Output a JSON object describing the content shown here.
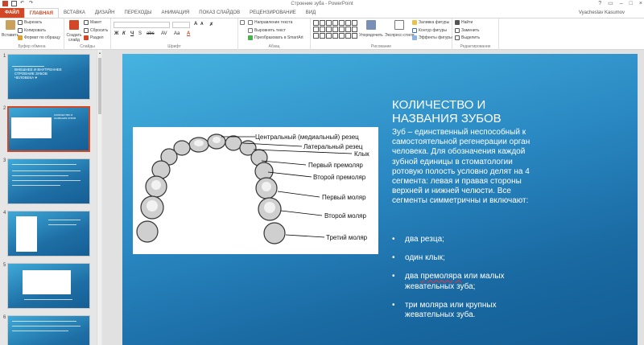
{
  "window": {
    "title": "Строение зуба - PowerPoint",
    "user": "Vyacheslav Kasumov",
    "controls": [
      "?",
      "▭",
      "–",
      "□",
      "×"
    ]
  },
  "ribbon": {
    "tabs": [
      "ФАЙЛ",
      "ГЛАВНАЯ",
      "ВСТАВКА",
      "ДИЗАЙН",
      "ПЕРЕХОДЫ",
      "АНИМАЦИЯ",
      "ПОКАЗ СЛАЙДОВ",
      "РЕЦЕНЗИРОВАНИЕ",
      "ВИД"
    ],
    "active_tab": "ГЛАВНАЯ",
    "clipboard": {
      "paste": "Вставить",
      "cut": "Вырезать",
      "copy": "Копировать",
      "format_painter": "Формат по образцу",
      "label": "Буфер обмена"
    },
    "slides": {
      "new_slide": "Создать слайд",
      "layout": "Макет",
      "reset": "Сбросить",
      "section": "Раздел",
      "label": "Слайды"
    },
    "font": {
      "name": "",
      "size": "",
      "bold": "Ж",
      "italic": "К",
      "underline": "Ч",
      "strike": "S",
      "shadow": "abc",
      "spacing": "AV",
      "case": "Aa",
      "label": "Шрифт"
    },
    "paragraph": {
      "text_direction": "Направление текста",
      "align_text": "Выровнять текст",
      "smartart": "Преобразовать в SmartArt",
      "label": "Абзац"
    },
    "drawing": {
      "arrange": "Упорядочить",
      "quick_styles": "Экспресс-стили",
      "fill": "Заливка фигуры",
      "outline": "Контур фигуры",
      "effects": "Эффекты фигуры",
      "label": "Рисование"
    },
    "editing": {
      "find": "Найти",
      "replace": "Заменить",
      "select": "Выделить",
      "label": "Редактирование"
    }
  },
  "thumbnails": [
    {
      "number": "1",
      "text": "ВНЕШНЕЕ И ВНУТРЕННЕЕ СТРОЕНИЕ ЗУБОВ ЧЕЛОВЕКА ♥"
    },
    {
      "number": "2",
      "text": "КОЛИЧЕСТВО И НАЗВАНИЯ ЗУБОВ"
    },
    {
      "number": "3",
      "text": ""
    },
    {
      "number": "4",
      "text": ""
    },
    {
      "number": "5",
      "text": ""
    },
    {
      "number": "6",
      "text": ""
    }
  ],
  "slide": {
    "title": "КОЛИЧЕСТВО И НАЗВАНИЯ ЗУБОВ",
    "paragraph": "Зуб – единственный неспособный к самостоятельной регенерации орган человека. Для обозначения каждой зубной единицы в стоматологии ротовую полость условно делят на 4 сегмента: левая и правая стороны верхней и нижней челюсти. Все сегменты симметричны и включают:",
    "bullets": [
      "два резца;",
      "один клык;",
      "премоляра",
      "или малых жевательных зуба;",
      "три моляра или крупных жевательных зуба."
    ],
    "bullet_prefix": "два ",
    "image_labels": [
      "Центральный (медиальный) резец",
      "Латеральный резец",
      "Клык",
      "Первый премоляр",
      "Второй премоляр",
      "Первый моляр",
      "Второй моляр",
      "Третий моляр"
    ]
  },
  "colors": {
    "accent": "#d24726",
    "slide_bg": "#2a88c2"
  }
}
